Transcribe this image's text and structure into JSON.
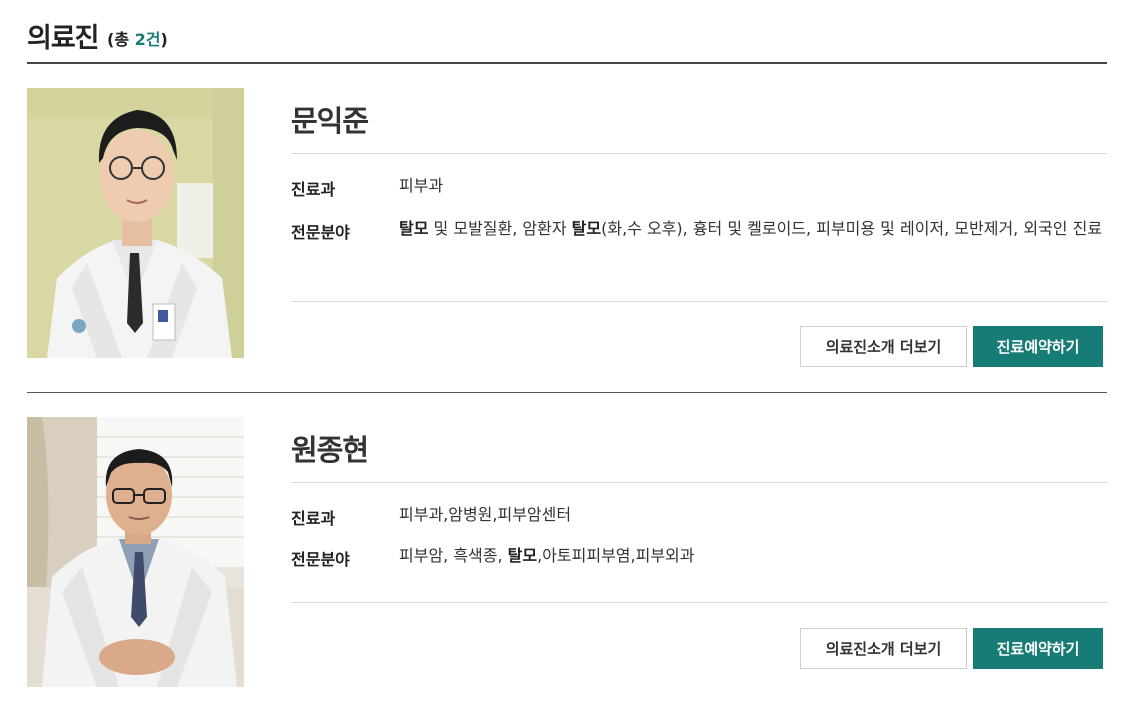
{
  "header": {
    "title": "의료진",
    "count_prefix": "(총 ",
    "count_value": "2건",
    "count_suffix": ")"
  },
  "colors": {
    "accent": "#177b76",
    "divider": "#444444",
    "light_rule": "#d7d7d7"
  },
  "doctors": [
    {
      "name": "문익준",
      "dept_label": "진료과",
      "dept_value": "피부과",
      "specialty_label": "전문분야",
      "specialty_parts": [
        {
          "text": "탈모",
          "bold": true
        },
        {
          "text": " 및 모발질환, 암환자 ",
          "bold": false
        },
        {
          "text": "탈모",
          "bold": true
        },
        {
          "text": "(화,수 오후), 흉터 및 켈로이드, 피부미용 및 레이저, 모반제거, 외국인 진료",
          "bold": false
        }
      ],
      "more_label": "의료진소개 더보기",
      "book_label": "진료예약하기"
    },
    {
      "name": "원종현",
      "dept_label": "진료과",
      "dept_value": "피부과,암병원,피부암센터",
      "specialty_label": "전문분야",
      "specialty_parts": [
        {
          "text": "피부암, 흑색종, ",
          "bold": false
        },
        {
          "text": "탈모",
          "bold": true
        },
        {
          "text": ",아토피피부염,피부외과",
          "bold": false
        }
      ],
      "more_label": "의료진소개 더보기",
      "book_label": "진료예약하기"
    }
  ]
}
